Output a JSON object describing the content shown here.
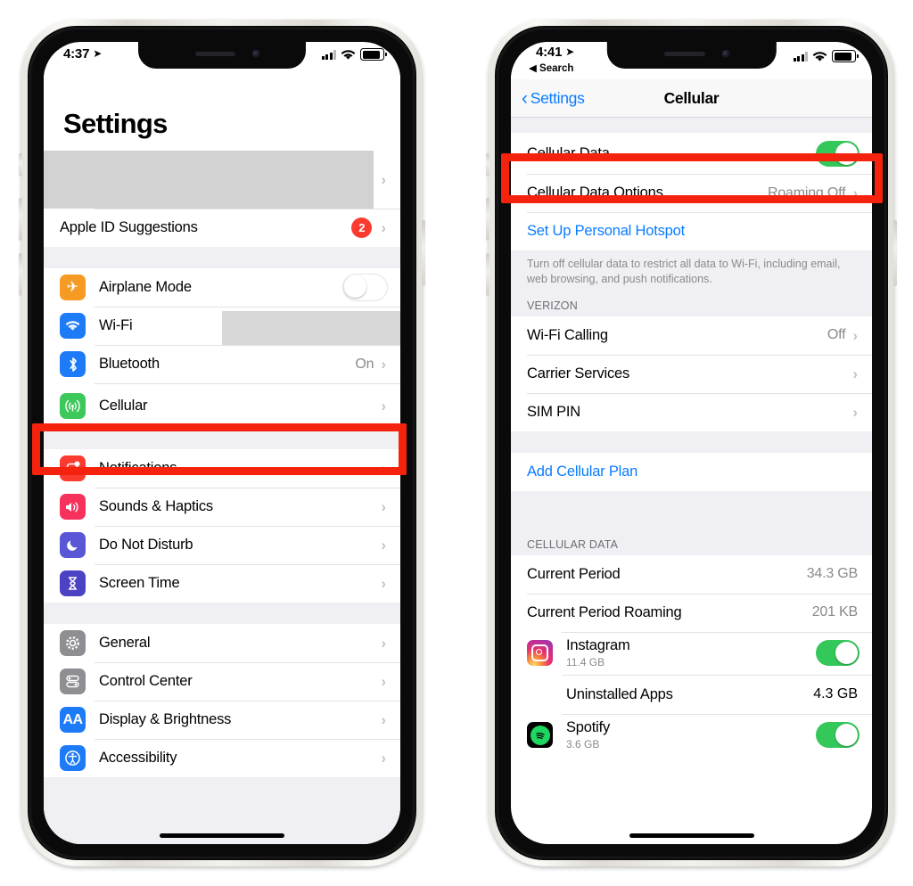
{
  "left_phone": {
    "status": {
      "time": "4:37",
      "location_icon": "location-arrow-icon",
      "battery_pct": 78
    },
    "title": "Settings",
    "profile_row": {
      "redacted": true,
      "chevron": "›"
    },
    "apple_id_row": {
      "label": "Apple ID Suggestions",
      "badge": "2",
      "chevron": "›"
    },
    "group1": [
      {
        "label": "Airplane Mode",
        "icon": "airplane-icon",
        "toggle": "off"
      },
      {
        "label": "Wi-Fi",
        "icon": "wifi-icon",
        "value_redacted": true
      },
      {
        "label": "Bluetooth",
        "icon": "bluetooth-icon",
        "value": "On",
        "chevron": "›"
      },
      {
        "label": "Cellular",
        "icon": "cellular-icon",
        "chevron": "›",
        "highlighted": true
      }
    ],
    "group2": [
      {
        "label": "Notifications",
        "icon": "notifications-icon",
        "chevron": "›"
      },
      {
        "label": "Sounds & Haptics",
        "icon": "sounds-icon",
        "chevron": "›"
      },
      {
        "label": "Do Not Disturb",
        "icon": "moon-icon",
        "chevron": "›"
      },
      {
        "label": "Screen Time",
        "icon": "hourglass-icon",
        "chevron": "›"
      }
    ],
    "group3": [
      {
        "label": "General",
        "icon": "gear-icon",
        "chevron": "›"
      },
      {
        "label": "Control Center",
        "icon": "control-center-icon",
        "chevron": "›"
      },
      {
        "label": "Display & Brightness",
        "icon": "display-brightness-icon",
        "chevron": "›"
      },
      {
        "label": "Accessibility",
        "icon": "accessibility-icon",
        "chevron": "›"
      }
    ]
  },
  "right_phone": {
    "status": {
      "time": "4:41",
      "location_icon": "location-arrow-icon",
      "back_app": "Search",
      "battery_pct": 78
    },
    "navbar": {
      "back_label": "Settings",
      "back_chevron": "‹",
      "title": "Cellular"
    },
    "group1": [
      {
        "label": "Cellular Data",
        "toggle": "on",
        "highlighted": true
      },
      {
        "label": "Cellular Data Options",
        "value": "Roaming Off",
        "chevron": "›"
      },
      {
        "label": "Set Up Personal Hotspot",
        "type": "link"
      }
    ],
    "footnote": "Turn off cellular data to restrict all data to Wi-Fi, including email, web browsing, and push notifications.",
    "carrier_header": "VERIZON",
    "group2": [
      {
        "label": "Wi-Fi Calling",
        "value": "Off",
        "chevron": "›"
      },
      {
        "label": "Carrier Services",
        "chevron": "›"
      },
      {
        "label": "SIM PIN",
        "chevron": "›"
      }
    ],
    "group3": [
      {
        "label": "Add Cellular Plan",
        "type": "link"
      }
    ],
    "data_header": "CELLULAR DATA",
    "data_rows": [
      {
        "label": "Current Period",
        "value": "34.3 GB"
      },
      {
        "label": "Current Period Roaming",
        "value": "201 KB"
      }
    ],
    "apps": [
      {
        "name": "Instagram",
        "size": "11.4 GB",
        "icon": "instagram-icon",
        "toggle": "on"
      },
      {
        "name": "Uninstalled Apps",
        "size": "",
        "value": "4.3 GB",
        "icon": "none"
      },
      {
        "name": "Spotify",
        "size": "3.6 GB",
        "icon": "spotify-icon",
        "toggle": "on"
      }
    ]
  },
  "annotations": {
    "highlight_color": "#f5230d",
    "boxes": [
      {
        "name": "cellular-row-highlight",
        "target": "Cellular"
      },
      {
        "name": "cellular-data-row-highlight",
        "target": "Cellular Data"
      }
    ]
  }
}
